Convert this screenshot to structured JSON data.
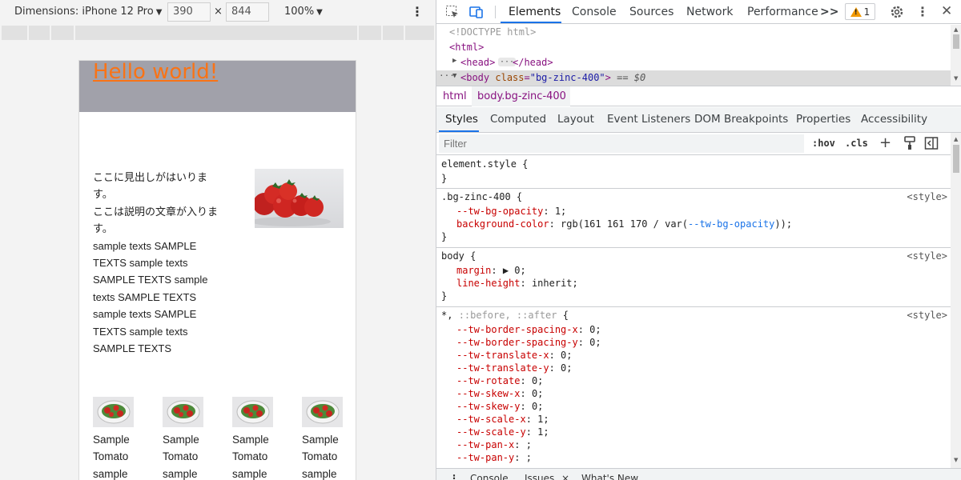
{
  "device_toolbar": {
    "dimensions_label": "Dimensions: iPhone 12 Pro",
    "width": "390",
    "height": "844",
    "times": "×",
    "zoom": "100%"
  },
  "page": {
    "heading_link": "Hello world!",
    "body_lines": [
      "ここに見出しがはいります。",
      "ここは説明の文章が入りま",
      "す。",
      "sample texts SAMPLE",
      "TEXTS sample texts",
      "SAMPLE TEXTS sample",
      "texts SAMPLE TEXTS",
      "sample texts SAMPLE",
      "TEXTS sample texts",
      "SAMPLE TEXTS"
    ],
    "cards": [
      {
        "lines": [
          "Sample",
          "Tomato",
          "sample"
        ]
      },
      {
        "lines": [
          "Sample",
          "Tomato",
          "sample"
        ]
      },
      {
        "lines": [
          "Sample",
          "Tomato",
          "sample"
        ]
      },
      {
        "lines": [
          "Sample",
          "Tomato",
          "sample"
        ]
      }
    ]
  },
  "devtools": {
    "tabs": [
      "Elements",
      "Console",
      "Sources",
      "Network",
      "Performance"
    ],
    "more_tabs": ">>",
    "warning_count": "1",
    "dom": {
      "doctype": "<!DOCTYPE html>",
      "html_open": "<html>",
      "head_open": "<head>",
      "head_close": "</head>",
      "ellipsis": "···",
      "body_tag": "body",
      "body_attr_name": "class",
      "body_attr_value": "\"bg-zinc-400\"",
      "selected_marker": "== $0",
      "gutter_dots": "···"
    },
    "breadcrumbs": [
      "html",
      "body.bg-zinc-400"
    ],
    "sub_tabs": [
      "Styles",
      "Computed",
      "Layout",
      "Event Listeners",
      "DOM Breakpoints",
      "Properties",
      "Accessibility"
    ],
    "filter_placeholder": "Filter",
    "filter_buttons": [
      ":hov",
      ".cls"
    ],
    "rules": {
      "element_style": {
        "selector": "element.style {",
        "close": "}"
      },
      "bg_zinc": {
        "selector": ".bg-zinc-400 {",
        "source": "<style>",
        "p1_name": "--tw-bg-opacity",
        "p1_value": " 1;",
        "p2_name": "background-color",
        "p2_value_a": " rgb(161 161 170 / var(",
        "p2_var": "--tw-bg-opacity",
        "p2_value_b": "));",
        "close": "}"
      },
      "body": {
        "selector": "body {",
        "source": "<style>",
        "p1_name": "margin",
        "p1_value": " ▶ 0;",
        "p2_name": "line-height",
        "p2_value": " inherit;",
        "close": "}"
      },
      "universal": {
        "selector_a": "*, ",
        "selector_b": "::before, ::after",
        "selector_c": " {",
        "source": "<style>",
        "props": [
          {
            "name": "--tw-border-spacing-x",
            "value": " 0;"
          },
          {
            "name": "--tw-border-spacing-y",
            "value": " 0;"
          },
          {
            "name": "--tw-translate-x",
            "value": " 0;"
          },
          {
            "name": "--tw-translate-y",
            "value": " 0;"
          },
          {
            "name": "--tw-rotate",
            "value": " 0;"
          },
          {
            "name": "--tw-skew-x",
            "value": " 0;"
          },
          {
            "name": "--tw-skew-y",
            "value": " 0;"
          },
          {
            "name": "--tw-scale-x",
            "value": " 1;"
          },
          {
            "name": "--tw-scale-y",
            "value": " 1;"
          },
          {
            "name": "--tw-pan-x",
            "value": " ;"
          },
          {
            "name": "--tw-pan-y",
            "value": " ;"
          }
        ]
      }
    },
    "drawer_tabs": [
      "Console",
      "Issues",
      "What's New"
    ],
    "drawer_close": "×"
  },
  "colors": {
    "header_bg": "#a1a1aa",
    "link": "#f97316",
    "accent": "#1a73e8",
    "warning": "#f29900"
  }
}
